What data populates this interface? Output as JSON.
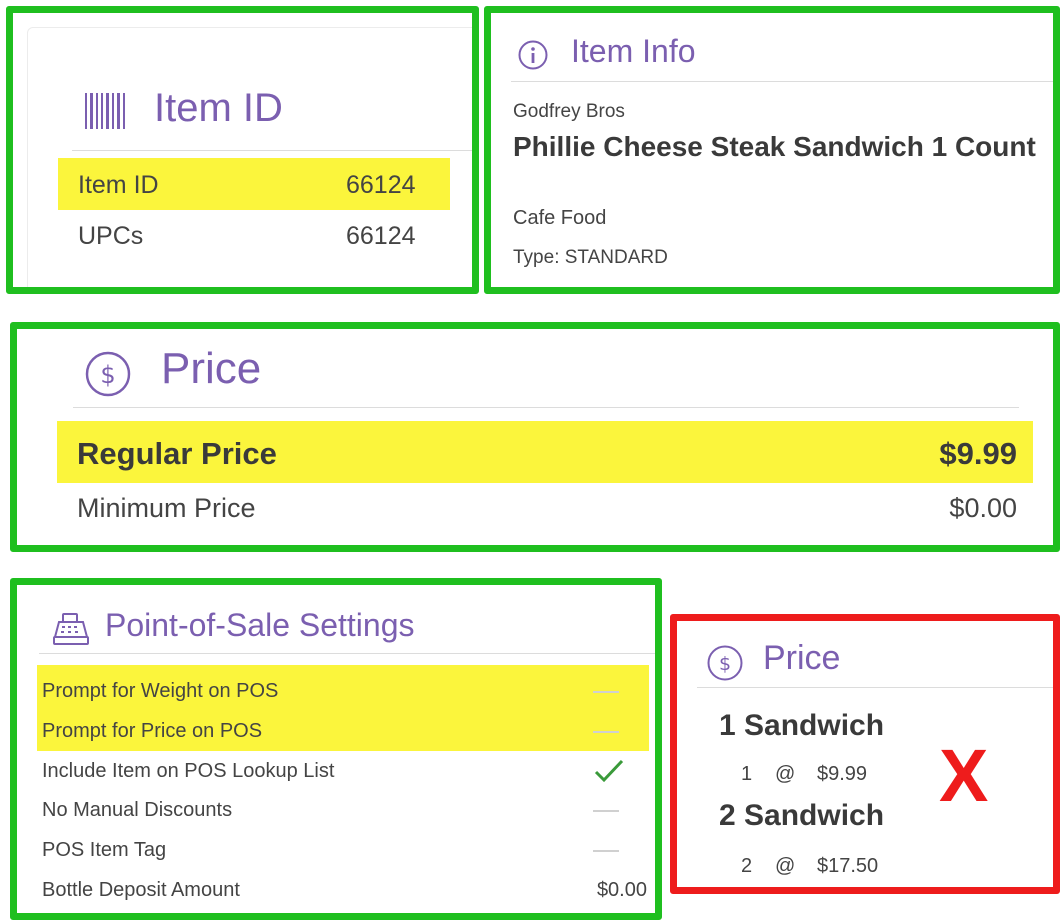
{
  "item_id_card": {
    "title": "Item ID",
    "icon": "barcode-icon",
    "rows": [
      {
        "label": "Item ID",
        "value": "66124"
      },
      {
        "label": "UPCs",
        "value": "66124"
      }
    ]
  },
  "item_info_card": {
    "title": "Item Info",
    "icon": "info-icon",
    "brand": "Godfrey Bros",
    "name": "Phillie Cheese Steak Sandwich 1 Count",
    "category": "Cafe Food",
    "type": "Type: STANDARD"
  },
  "price_card": {
    "title": "Price",
    "icon": "dollar-icon",
    "rows": [
      {
        "label": "Regular Price",
        "value": "$9.99"
      },
      {
        "label": "Minimum Price",
        "value": "$0.00"
      }
    ]
  },
  "pos_card": {
    "title": "Point-of-Sale Settings",
    "icon": "cash-register-icon",
    "rows": [
      {
        "label": "Prompt for Weight on POS",
        "value": "—",
        "state": "off"
      },
      {
        "label": "Prompt for Price on POS",
        "value": "—",
        "state": "off"
      },
      {
        "label": "Include Item on POS Lookup List",
        "value": "✓",
        "state": "on"
      },
      {
        "label": "No Manual Discounts",
        "value": "—",
        "state": "off"
      },
      {
        "label": "POS Item Tag",
        "value": "—",
        "state": "off"
      },
      {
        "label": "Bottle Deposit Amount",
        "value": "$0.00",
        "state": "text"
      }
    ]
  },
  "price_tier_card": {
    "title": "Price",
    "icon": "dollar-icon",
    "mark": "X",
    "tiers": [
      {
        "name": "1 Sandwich",
        "qty": "1",
        "at": "@",
        "price": "$9.99"
      },
      {
        "name": "2 Sandwich",
        "qty": "2",
        "at": "@",
        "price": "$17.50"
      }
    ]
  },
  "colors": {
    "accent": "#7b5fb0",
    "frame_ok": "#1fbf1f",
    "frame_bad": "#ee1c1c",
    "highlight": "#fbf53c",
    "check": "#3a9a3a"
  }
}
